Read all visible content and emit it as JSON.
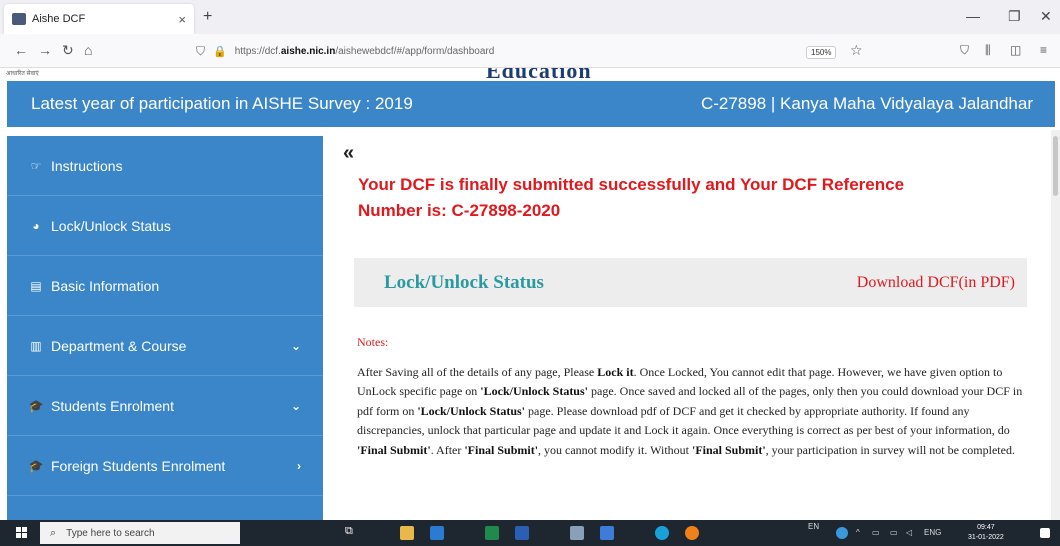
{
  "browser": {
    "tab_title": "Aishe DCF",
    "tab_close": "×",
    "new_tab": "+",
    "url_prefix": "https://dcf.",
    "url_domain": "aishe.nic.in",
    "url_path": "/aishewebdcf/#/app/form/dashboard",
    "zoom": "150%"
  },
  "page_header": {
    "small_text": "आधारित सेवाएं",
    "big_text": "Education"
  },
  "participation_bar": {
    "left": "Latest year of participation in AISHE Survey : 2019",
    "right": "C-27898 | Kanya Maha Vidyalaya Jalandhar"
  },
  "sidebar": {
    "items": [
      {
        "label": "Instructions",
        "icon": "hand-pointer-icon",
        "glyph": "☞",
        "chevron": ""
      },
      {
        "label": "Lock/Unlock Status",
        "icon": "dashboard-icon",
        "glyph": "◕",
        "chevron": ""
      },
      {
        "label": "Basic Information",
        "icon": "id-card-icon",
        "glyph": "▤",
        "chevron": ""
      },
      {
        "label": "Department & Course",
        "icon": "building-icon",
        "glyph": "▥",
        "chevron": "⌄"
      },
      {
        "label": "Students Enrolment",
        "icon": "graduation-cap-icon",
        "glyph": "🎓",
        "chevron": "⌄"
      },
      {
        "label": "Foreign Students Enrolment",
        "icon": "graduation-cap-icon",
        "glyph": "🎓",
        "chevron": "›"
      }
    ]
  },
  "main": {
    "collapse_glyph": "«",
    "success_line1": "Your DCF is finally submitted successfully and Your DCF Reference",
    "success_line2": "Number is: C-27898-2020",
    "status_title": "Lock/Unlock Status",
    "download_link": "Download DCF(in PDF)",
    "notes_label": "Notes:",
    "notes": [
      {
        "t": "After Saving all of the details of any page, Please ",
        "b": false
      },
      {
        "t": "Lock it",
        "b": true
      },
      {
        "t": ". Once Locked, You cannot edit that page. However, we have given option to UnLock specific page on ",
        "b": false
      },
      {
        "t": "'Lock/Unlock Status'",
        "b": true
      },
      {
        "t": " page. Once saved and locked all of the pages, only then you could download your DCF in pdf form on ",
        "b": false
      },
      {
        "t": "'Lock/Unlock Status'",
        "b": true
      },
      {
        "t": " page. Please download pdf of DCF and get it checked by appropriate authority. If found any discrepancies, unlock that particular page and update it and Lock it again. Once everything is correct as per best of your information, do ",
        "b": false
      },
      {
        "t": "'Final Submit'",
        "b": true
      },
      {
        "t": ". After ",
        "b": false
      },
      {
        "t": "'Final Submit'",
        "b": true
      },
      {
        "t": ", you cannot modify it. Without ",
        "b": false
      },
      {
        "t": "'Final Submit'",
        "b": true
      },
      {
        "t": ", your participation in survey will not be completed.",
        "b": false
      }
    ]
  },
  "taskbar": {
    "search_placeholder": "Type here to search",
    "lang": "ENG",
    "en": "EN",
    "time": "09:47",
    "date": "31-01-2022"
  },
  "colors": {
    "sidebar_blue": "#3a86c8",
    "success_red": "#e0191e",
    "status_teal": "#2a9aa0"
  }
}
